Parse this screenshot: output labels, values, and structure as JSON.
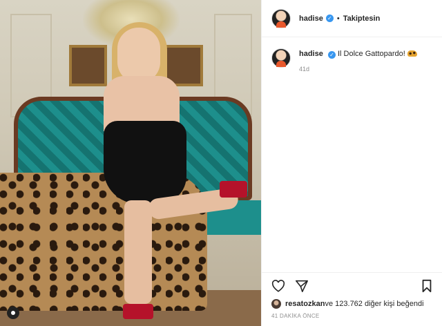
{
  "header": {
    "username": "hadise",
    "separator": "•",
    "follow_state": "Takiptesin"
  },
  "caption": {
    "username": "hadise",
    "text": "Il Dolce Gattopardo!",
    "emoji": "leopard-icon",
    "age": "41d"
  },
  "footer": {
    "liked_by_user": "resatozkan",
    "likes_text": " ve 123.762 diğer kişi beğendi",
    "posted_ago": "41 DAKİKA ÖNCE"
  },
  "icons": {
    "like": "heart-icon",
    "share": "direct-share-icon",
    "save": "bookmark-icon",
    "verified": "verified-badge-icon"
  },
  "colors": {
    "verified": "#3897f0",
    "muted_text": "#8e8e8e",
    "text": "#262626"
  }
}
